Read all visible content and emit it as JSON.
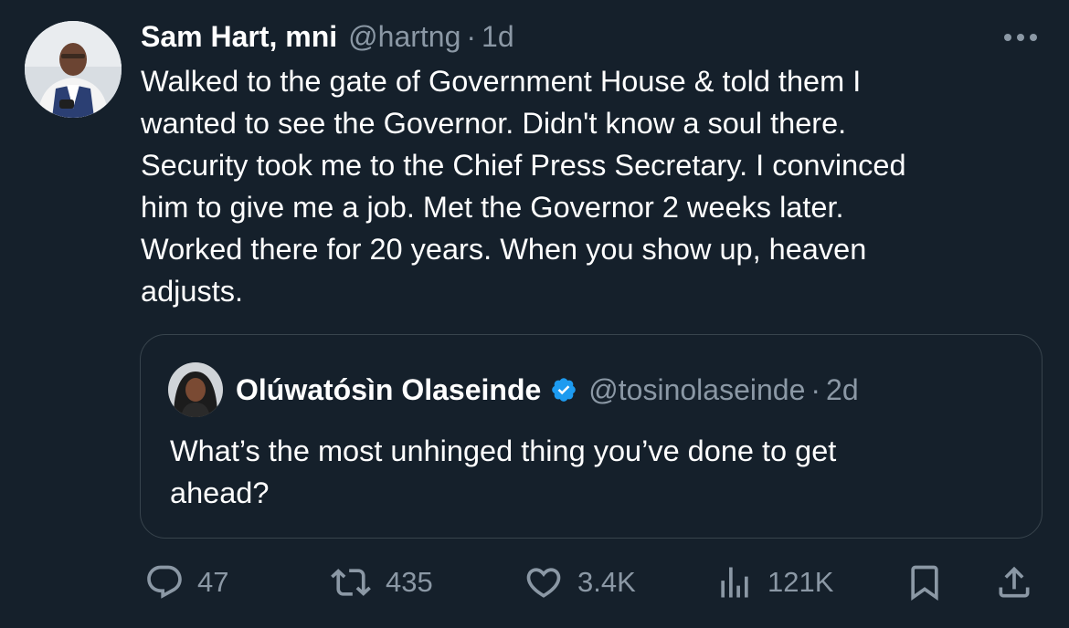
{
  "tweet": {
    "author": {
      "display_name": "Sam Hart, mni",
      "handle": "@hartng",
      "separator": "·",
      "time": "1d"
    },
    "text_lines": [
      "Walked to the gate of Government House & told them I",
      "wanted to see the Governor. Didn't know a soul there.",
      "Security took me to the Chief Press Secretary. I convinced",
      "him to give me a job. Met the Governor 2 weeks later.",
      "Worked there for 20 years. When you show up, heaven",
      "adjusts."
    ],
    "more_icon": "ellipsis-icon"
  },
  "quote": {
    "author": {
      "display_name": "Olúwatósìn Olaseinde",
      "verified": true,
      "handle": "@tosinolaseinde",
      "separator": "·",
      "time": "2d"
    },
    "text_lines": [
      "What’s the most unhinged thing you’ve done to get",
      "ahead?"
    ]
  },
  "actions": {
    "replies": {
      "icon": "reply-icon",
      "count": "47"
    },
    "reposts": {
      "icon": "repost-icon",
      "count": "435"
    },
    "likes": {
      "icon": "heart-icon",
      "count": "3.4K"
    },
    "views": {
      "icon": "views-icon",
      "count": "121K"
    },
    "bookmark": {
      "icon": "bookmark-icon"
    },
    "share": {
      "icon": "share-icon"
    }
  },
  "colors": {
    "background": "#15202b",
    "text_primary": "#ffffff",
    "text_secondary": "#8b98a5",
    "border": "#38444d",
    "verified_badge": "#1d9bf0"
  }
}
